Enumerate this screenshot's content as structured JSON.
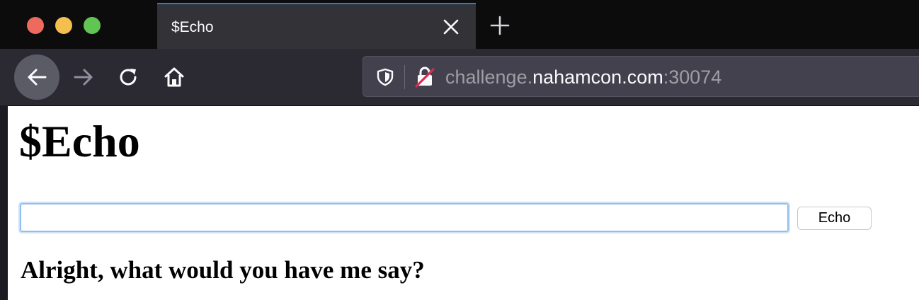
{
  "window": {
    "traffic_lights": [
      "close",
      "minimize",
      "zoom"
    ]
  },
  "tabs": [
    {
      "title": "$Echo",
      "active": true
    }
  ],
  "toolbar": {
    "icons": {
      "back": "arrow-left-icon",
      "forward": "arrow-right-icon",
      "reload": "reload-icon",
      "home": "home-icon",
      "tracking_protection": "shield-icon",
      "connection": "insecure-lock-icon",
      "close_tab": "close-icon",
      "new_tab": "plus-icon"
    },
    "url": {
      "prefix": "challenge.",
      "domain": "nahamcon.com",
      "port": ":30074"
    }
  },
  "page": {
    "heading": "$Echo",
    "input": {
      "value": "",
      "placeholder": ""
    },
    "button_label": "Echo",
    "prompt": "Alright, what would you have me say?"
  },
  "colors": {
    "tab_accent": "#0a84ff",
    "insecure_strike": "#e22850",
    "page_background": "#ffffff",
    "input_focus_border": "#8fbfee"
  }
}
